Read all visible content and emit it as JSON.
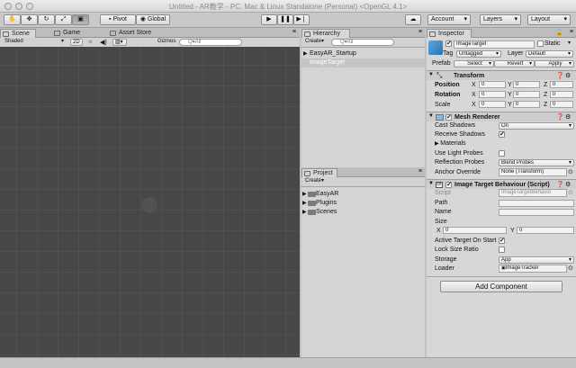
{
  "window": {
    "title": "Untitled - AR教学 - PC, Mac & Linux Standalone (Personal) <OpenGL 4.1>"
  },
  "toolbar": {
    "pivot_label": "Pivot",
    "global_label": "Global",
    "account_label": "Account",
    "layers_label": "Layers",
    "layout_label": "Layout"
  },
  "scene_panel": {
    "tabs": [
      "Scene",
      "Game",
      "Asset Store"
    ],
    "shading": "Shaded",
    "mode_2d": "2D",
    "gizmos": "Gizmos",
    "search_placeholder": "Q▾All"
  },
  "hierarchy": {
    "tab": "Hierarchy",
    "create": "Create",
    "search_placeholder": "Q▾All",
    "items": [
      "EasyAR_Startup",
      "ImageTarget"
    ],
    "selected_index": 1
  },
  "project": {
    "tab": "Project",
    "create": "Create",
    "folders": [
      "EasyAR",
      "Plugins",
      "Scenes"
    ]
  },
  "inspector": {
    "tab": "Inspector",
    "object_name": "ImageTarget",
    "static_label": "Static",
    "tag_label": "Tag",
    "tag_value": "Untagged",
    "layer_label": "Layer",
    "layer_value": "Default",
    "prefab_label": "Prefab",
    "prefab_buttons": [
      "Select",
      "Revert",
      "Apply"
    ],
    "transform": {
      "title": "Transform",
      "rows": [
        {
          "label": "Position",
          "x": "0",
          "y": "0",
          "z": "0"
        },
        {
          "label": "Rotation",
          "x": "0",
          "y": "0",
          "z": "0"
        },
        {
          "label": "Scale",
          "x": "0",
          "y": "0",
          "z": "0"
        }
      ]
    },
    "mesh_renderer": {
      "title": "Mesh Renderer",
      "cast_shadows_label": "Cast Shadows",
      "cast_shadows_value": "On",
      "receive_shadows_label": "Receive Shadows",
      "materials_label": "Materials",
      "light_probes_label": "Use Light Probes",
      "reflection_probes_label": "Reflection Probes",
      "reflection_probes_value": "Blend Probes",
      "anchor_label": "Anchor Override",
      "anchor_value": "None (Transform)"
    },
    "image_target": {
      "title": "Image Target Behaviour (Script)",
      "script_label": "Script",
      "script_value": "ImageTargetBehavio",
      "path_label": "Path",
      "name_label": "Name",
      "size_label": "Size",
      "size_x": "0",
      "size_y": "0",
      "active_label": "Active Target On Start",
      "lock_label": "Lock Size Ratio",
      "storage_label": "Storage",
      "storage_value": "App",
      "loader_label": "Loader",
      "loader_value": "ImageTracker"
    },
    "add_component": "Add Component"
  }
}
